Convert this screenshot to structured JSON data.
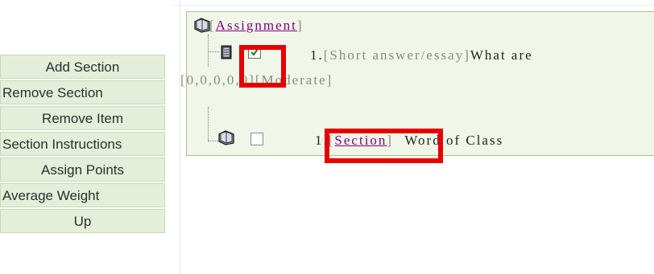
{
  "sidebar": {
    "buttons": [
      {
        "label": "Add Section"
      },
      {
        "label": "Remove Section"
      },
      {
        "label": "Remove Item"
      },
      {
        "label": "Section Instructions"
      },
      {
        "label": "Assign Points"
      },
      {
        "label": "Average Weight"
      },
      {
        "label": "Up"
      }
    ]
  },
  "tree": {
    "root": {
      "label": "Assignment"
    },
    "item": {
      "number": "1.",
      "type": "[Short answer/essay]",
      "text": "What are",
      "scores": "[0,0,0,0,0][Moderate]",
      "checked": true
    },
    "section": {
      "number": "1.",
      "link": "Section",
      "title": "Word of Class",
      "checked": false
    }
  },
  "colors": {
    "highlight": "#e60000",
    "button_bg": "#e4efd9",
    "tree_bg": "#f0f7e8",
    "link": "#800080"
  }
}
